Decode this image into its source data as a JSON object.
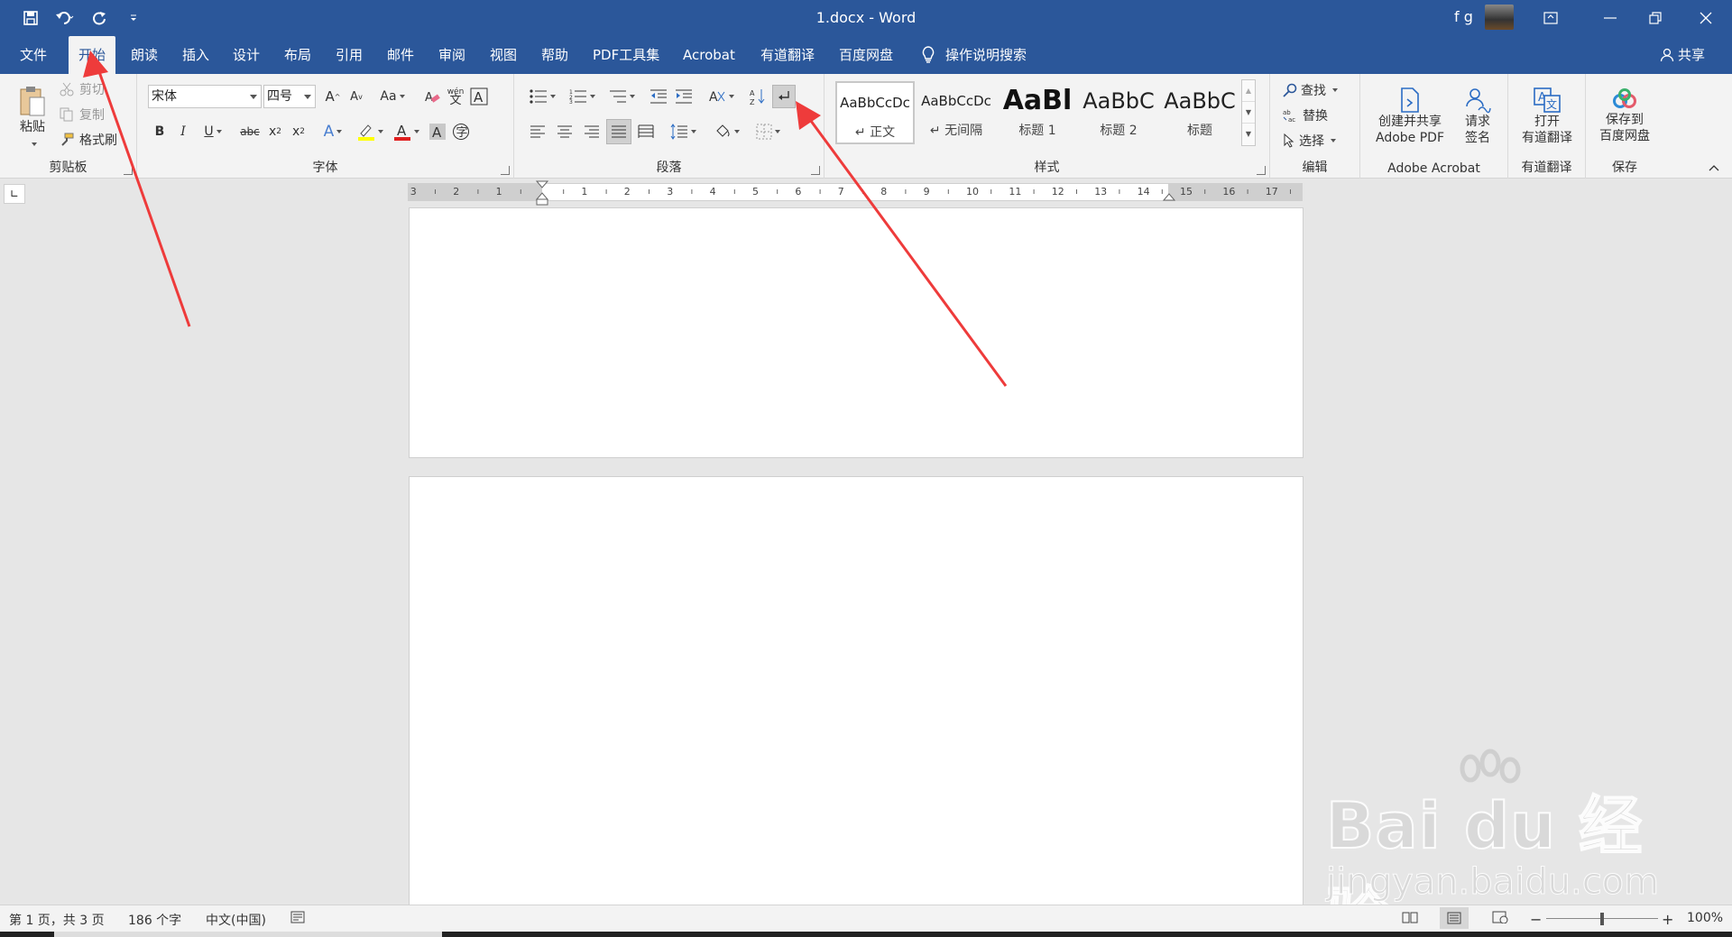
{
  "window": {
    "title": "1.docx  -  Word",
    "user": "f g"
  },
  "tabs": [
    "文件",
    "开始",
    "朗读",
    "插入",
    "设计",
    "布局",
    "引用",
    "邮件",
    "审阅",
    "视图",
    "帮助",
    "PDF工具集",
    "Acrobat",
    "有道翻译",
    "百度网盘",
    "操作说明搜索"
  ],
  "active_tab": "开始",
  "share_label": "共享",
  "clipboard": {
    "paste": "粘贴",
    "cut": "剪切",
    "copy": "复制",
    "format_painter": "格式刷",
    "label": "剪贴板"
  },
  "font": {
    "name": "宋体",
    "size": "四号",
    "case_label": "Aa",
    "label": "字体"
  },
  "paragraph": {
    "label": "段落"
  },
  "styles": {
    "label": "样式",
    "items": [
      {
        "preview": "AaBbCcDc",
        "name": "↵ 正文"
      },
      {
        "preview": "AaBbCcDc",
        "name": "↵ 无间隔"
      },
      {
        "preview": "AaBl",
        "name": "标题 1"
      },
      {
        "preview": "AaBbC",
        "name": "标题 2"
      },
      {
        "preview": "AaBbC",
        "name": "标题"
      }
    ]
  },
  "editing": {
    "find": "查找",
    "replace": "替换",
    "select": "选择",
    "label": "编辑"
  },
  "acrobat": {
    "create_share_1": "创建并共享",
    "create_share_2": "Adobe PDF",
    "request_sign_1": "请求",
    "request_sign_2": "签名",
    "label": "Adobe Acrobat"
  },
  "youdao": {
    "open_1": "打开",
    "open_2": "有道翻译",
    "label": "有道翻译"
  },
  "baidu": {
    "save_1": "保存到",
    "save_2": "百度网盘",
    "label": "保存"
  },
  "ruler_numbers": [
    "3",
    "2",
    "1",
    "1",
    "2",
    "3",
    "4",
    "5",
    "6",
    "7",
    "8",
    "9",
    "10",
    "11",
    "12",
    "13",
    "14",
    "15",
    "16",
    "17"
  ],
  "status": {
    "page": "第 1 页，共 3 页",
    "words": "186 个字",
    "lang": "中文(中国)",
    "zoom": "100%"
  },
  "watermark": {
    "brand": "Bai du 经验",
    "url": "jingyan.baidu.com"
  },
  "colors": {
    "ribbon_blue": "#2b579a",
    "arrow_red": "#ee3b3b"
  }
}
